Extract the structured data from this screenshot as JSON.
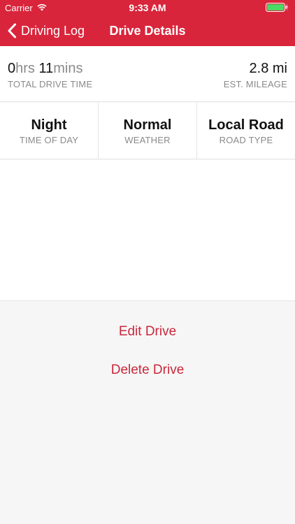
{
  "status_bar": {
    "carrier": "Carrier",
    "time": "9:33 AM"
  },
  "nav": {
    "back_label": "Driving Log",
    "title": "Drive Details"
  },
  "summary": {
    "hours_value": "0",
    "hours_unit": "hrs",
    "minutes_value": "11",
    "minutes_unit": "mins",
    "drive_time_caption": "TOTAL DRIVE TIME",
    "mileage_value": "2.8 mi",
    "mileage_caption": "EST. MILEAGE"
  },
  "conditions": [
    {
      "value": "Night",
      "caption": "TIME OF DAY"
    },
    {
      "value": "Normal",
      "caption": "WEATHER"
    },
    {
      "value": "Local Road",
      "caption": "ROAD TYPE"
    }
  ],
  "actions": {
    "edit_label": "Edit Drive",
    "delete_label": "Delete Drive"
  },
  "colors": {
    "brand": "#d9253b",
    "action_text": "#c8283c",
    "muted_text": "#8a8a8a",
    "battery": "#4cd964"
  }
}
